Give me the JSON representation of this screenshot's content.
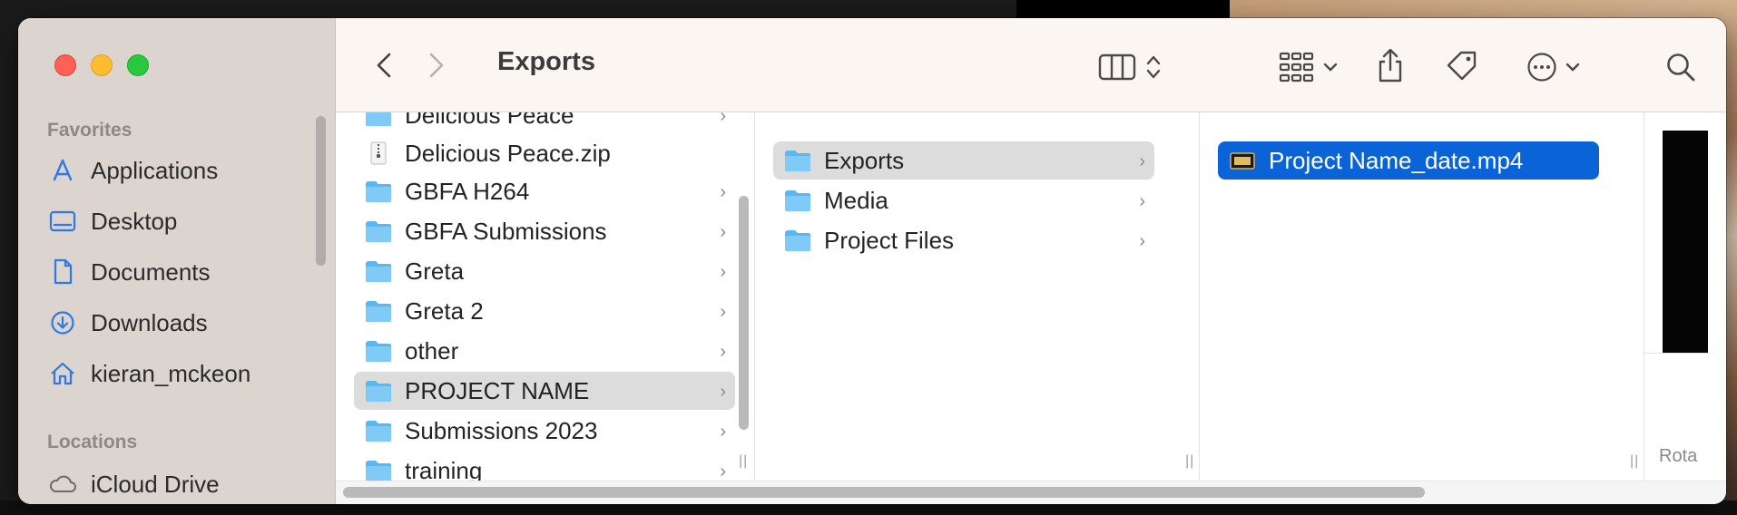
{
  "window": {
    "title": "Exports"
  },
  "sidebar": {
    "favorites_label": "Favorites",
    "favorites": [
      {
        "label": "Applications",
        "icon": "applications-icon"
      },
      {
        "label": "Desktop",
        "icon": "desktop-icon"
      },
      {
        "label": "Documents",
        "icon": "document-icon"
      },
      {
        "label": "Downloads",
        "icon": "downloads-icon"
      },
      {
        "label": "kieran_mckeon",
        "icon": "home-icon"
      }
    ],
    "locations_label": "Locations",
    "locations": [
      {
        "label": "iCloud Drive",
        "icon": "cloud-icon"
      }
    ]
  },
  "toolbar": {
    "view_icon": "column-view-icon",
    "group_icon": "group-grid-icon",
    "share_icon": "share-icon",
    "tag_icon": "tag-icon",
    "more_icon": "more-icon",
    "search_icon": "search-icon"
  },
  "column1": {
    "items": [
      {
        "label": "Delicious Peace",
        "type": "folder"
      },
      {
        "label": "Delicious Peace.zip",
        "type": "zip"
      },
      {
        "label": "GBFA H264",
        "type": "folder"
      },
      {
        "label": "GBFA Submissions",
        "type": "folder"
      },
      {
        "label": "Greta",
        "type": "folder"
      },
      {
        "label": "Greta 2",
        "type": "folder"
      },
      {
        "label": "other",
        "type": "folder"
      },
      {
        "label": "PROJECT NAME",
        "type": "folder",
        "selected": true
      },
      {
        "label": "Submissions 2023",
        "type": "folder"
      },
      {
        "label": "training",
        "type": "folder"
      }
    ]
  },
  "column2": {
    "items": [
      {
        "label": "Exports",
        "type": "folder",
        "selected": true
      },
      {
        "label": "Media",
        "type": "folder"
      },
      {
        "label": "Project Files",
        "type": "folder"
      }
    ]
  },
  "column3": {
    "items": [
      {
        "label": "Project Name_date.mp4",
        "type": "video",
        "selected": true
      }
    ]
  },
  "preview": {
    "partial_label": "Rota"
  },
  "colors": {
    "selection_blue": "#0a64d8",
    "folder_blue": "#5ab8f0",
    "sidebar_accent": "#2f78e6"
  }
}
